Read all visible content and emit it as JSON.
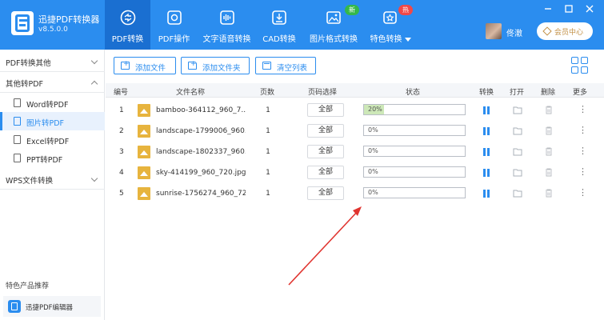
{
  "app": {
    "name": "迅捷PDF转换器",
    "version": "v8.5.0.0"
  },
  "nav": [
    {
      "label": "PDF转换",
      "icon": "convert-icon",
      "active": true
    },
    {
      "label": "PDF操作",
      "icon": "gear-icon"
    },
    {
      "label": "文字语音转换",
      "icon": "audio-icon"
    },
    {
      "label": "CAD转换",
      "icon": "cad-icon"
    },
    {
      "label": "图片格式转换",
      "icon": "image-icon",
      "badge": "新"
    },
    {
      "label": "特色转换",
      "icon": "star-icon",
      "badge": "热"
    }
  ],
  "user": {
    "name": "佟澈",
    "vip_label": "会员中心"
  },
  "sidebar": {
    "groups": [
      {
        "label": "PDF转换其他",
        "expanded": false
      },
      {
        "label": "其他转PDF",
        "expanded": true
      },
      {
        "label": "WPS文件转换",
        "expanded": false
      }
    ],
    "items": [
      {
        "label": "Word转PDF",
        "active": false
      },
      {
        "label": "图片转PDF",
        "active": true
      },
      {
        "label": "Excel转PDF",
        "active": false
      },
      {
        "label": "PPT转PDF",
        "active": false
      }
    ],
    "promo_title": "特色产品推荐",
    "promo_item": "迅捷PDF编辑器"
  },
  "toolbar": {
    "add_file": "添加文件",
    "add_folder": "添加文件夹",
    "clear_list": "清空列表"
  },
  "table": {
    "headers": {
      "index": "编号",
      "name": "文件名称",
      "pages": "页数",
      "range": "页码选择",
      "status": "状态",
      "convert": "转换",
      "open": "打开",
      "delete": "删除",
      "more": "更多"
    },
    "rows": [
      {
        "index": "1",
        "name": "bamboo-364112_960_7...",
        "pages": "1",
        "range": "全部",
        "progress": "20%",
        "fill": 0.2
      },
      {
        "index": "2",
        "name": "landscape-1799006_960...",
        "pages": "1",
        "range": "全部",
        "progress": "0%",
        "fill": 0
      },
      {
        "index": "3",
        "name": "landscape-1802337_960...",
        "pages": "1",
        "range": "全部",
        "progress": "0%",
        "fill": 0
      },
      {
        "index": "4",
        "name": "sky-414199_960_720.jpg",
        "pages": "1",
        "range": "全部",
        "progress": "0%",
        "fill": 0
      },
      {
        "index": "5",
        "name": "sunrise-1756274_960_72...",
        "pages": "1",
        "range": "全部",
        "progress": "0%",
        "fill": 0
      }
    ]
  },
  "colors": {
    "primary": "#2b8def",
    "active_tab": "#1a6fd1",
    "arrow": "#e0342f",
    "progress_fill": "#cde8b8"
  }
}
